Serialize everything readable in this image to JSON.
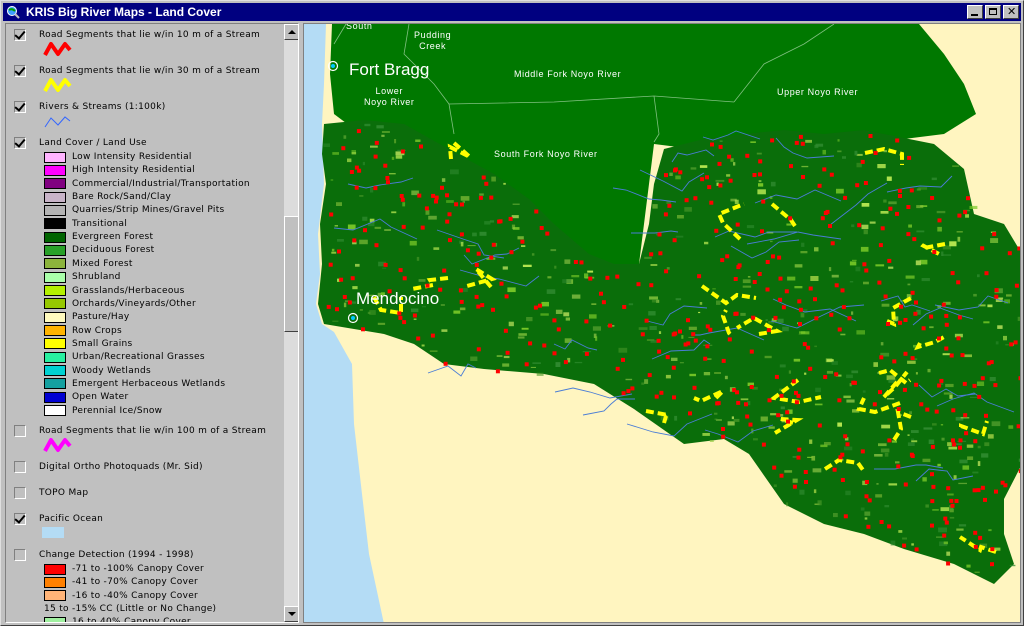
{
  "window": {
    "title": "KRIS Big River Maps - Land Cover"
  },
  "layers": {
    "road10": {
      "label": "Road Segments that lie w/in 10 m of a Stream",
      "checked": true,
      "color": "#ff0000"
    },
    "road30": {
      "label": "Road Segments that lie w/in 30 m of a Stream",
      "checked": true,
      "color": "#ffff00"
    },
    "rivers": {
      "label": "Rivers & Streams (1:100k)",
      "checked": true,
      "color": "#3366ff"
    },
    "landcover": {
      "label": "Land Cover / Land Use",
      "checked": true
    },
    "road100": {
      "label": "Road Segments that lie w/in 100 m of a Stream",
      "checked": false,
      "color": "#ff00ff"
    },
    "ortho": {
      "label": "Digital Ortho Photoquads (Mr. Sid)",
      "checked": false
    },
    "topo": {
      "label": "TOPO Map",
      "checked": false
    },
    "ocean": {
      "label": "Pacific Ocean",
      "checked": true,
      "color": "#b4dcf5"
    },
    "change": {
      "label": "Change Detection (1994 - 1998)",
      "checked": false
    }
  },
  "landcover_classes": [
    {
      "label": "Low Intensity Residential",
      "color": "#ffb4ff"
    },
    {
      "label": "High Intensity Residential",
      "color": "#ff00ff"
    },
    {
      "label": "Commercial/Industrial/Transportation",
      "color": "#800080"
    },
    {
      "label": "Bare Rock/Sand/Clay",
      "color": "#c8b4c8"
    },
    {
      "label": "Quarries/Strip Mines/Gravel Pits",
      "color": "#b4b4b4"
    },
    {
      "label": "Transitional",
      "color": "#000000"
    },
    {
      "label": "Evergreen Forest",
      "color": "#006400"
    },
    {
      "label": "Deciduous Forest",
      "color": "#28a028"
    },
    {
      "label": "Mixed Forest",
      "color": "#8cb43c"
    },
    {
      "label": "Shrubland",
      "color": "#aaffaa"
    },
    {
      "label": "Grasslands/Herbaceous",
      "color": "#b4f000"
    },
    {
      "label": "Orchards/Vineyards/Other",
      "color": "#96c800"
    },
    {
      "label": "Pasture/Hay",
      "color": "#fffabe"
    },
    {
      "label": "Row Crops",
      "color": "#ffb400"
    },
    {
      "label": "Small Grains",
      "color": "#ffff00"
    },
    {
      "label": "Urban/Recreational Grasses",
      "color": "#28f0a0"
    },
    {
      "label": "Woody Wetlands",
      "color": "#00d2d2"
    },
    {
      "label": "Emergent Herbaceous Wetlands",
      "color": "#14a0a0"
    },
    {
      "label": "Open Water",
      "color": "#0000d2"
    },
    {
      "label": "Perennial Ice/Snow",
      "color": "#ffffff"
    }
  ],
  "change_classes": [
    {
      "label": "-71 to -100% Canopy Cover",
      "color": "#ff0000"
    },
    {
      "label": "-41 to -70% Canopy Cover",
      "color": "#ff8000"
    },
    {
      "label": "-16 to -40% Canopy Cover",
      "color": "#ffb478"
    },
    {
      "label": "15 to -15% CC (Little or No Change)",
      "color": ""
    },
    {
      "label": "16 to 40% Canopy Cover",
      "color": "#a0f0a0"
    }
  ],
  "map": {
    "towns": {
      "fort_bragg": "Fort Bragg",
      "mendocino": "Mendocino"
    },
    "watersheds": {
      "south": "South",
      "pudding": "Pudding\nCreek",
      "middle_noyo": "Middle Fork Noyo River",
      "lower_noyo": "Lower\nNoyo River",
      "upper_noyo": "Upper Noyo River",
      "south_noyo": "South Fork Noyo River"
    },
    "colors": {
      "ocean": "#b4dcf5",
      "land": "#fff5c0",
      "noyo": "#007800",
      "forest": "#006400"
    }
  }
}
